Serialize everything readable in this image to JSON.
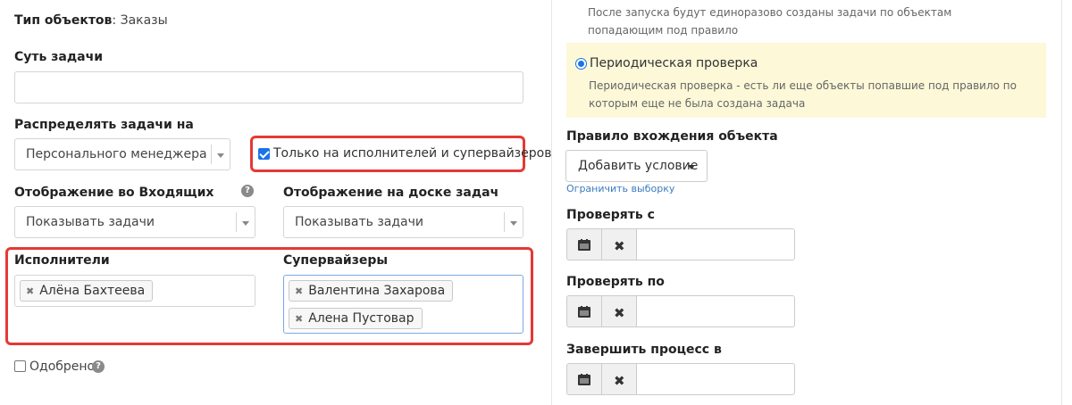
{
  "left": {
    "object_type_label": "Тип объектов",
    "object_type_value": ": Заказы",
    "task_essence_label": "Суть задачи",
    "task_essence_value": "",
    "distribute_label": "Распределять задачи на",
    "distribute_value": "Персонального менеджера",
    "only_executors_label": "Только на исполнителей и супервайзеров",
    "only_executors_checked": true,
    "inbox_display_label": "Отображение во Входящих",
    "inbox_display_value": "Показывать задачи",
    "board_display_label": "Отображение на доске задач",
    "board_display_value": "Показывать задачи",
    "executors_label": "Исполнители",
    "executors": [
      "Алёна Бахтеева"
    ],
    "supervisors_label": "Супервайзеры",
    "supervisors": [
      "Валентина Захарова",
      "Алена Пустовар"
    ],
    "approved_label": "Одобрено",
    "approved_checked": false,
    "help_glyph": "?"
  },
  "right": {
    "once_hint": "После запуска будут единоразово созданы задачи по объектам попадающим под правило",
    "periodic_label": "Периодическая проверка",
    "periodic_hint": "Периодическая проверка - есть ли еще объекты попавшие под правило по которым еще не была создана задача",
    "rule_label": "Правило вхождения объекта",
    "add_condition_label": "Добавить условие",
    "limit_link": "Ограничить выборку",
    "check_from_label": "Проверять с",
    "check_to_label": "Проверять по",
    "finish_label": "Завершить процесс в",
    "x_glyph": "✖"
  },
  "colors": {
    "highlight": "#e53935",
    "periodic_bg": "#fcf8d8",
    "accent": "#1a73e8",
    "link": "#3a7bbf"
  }
}
